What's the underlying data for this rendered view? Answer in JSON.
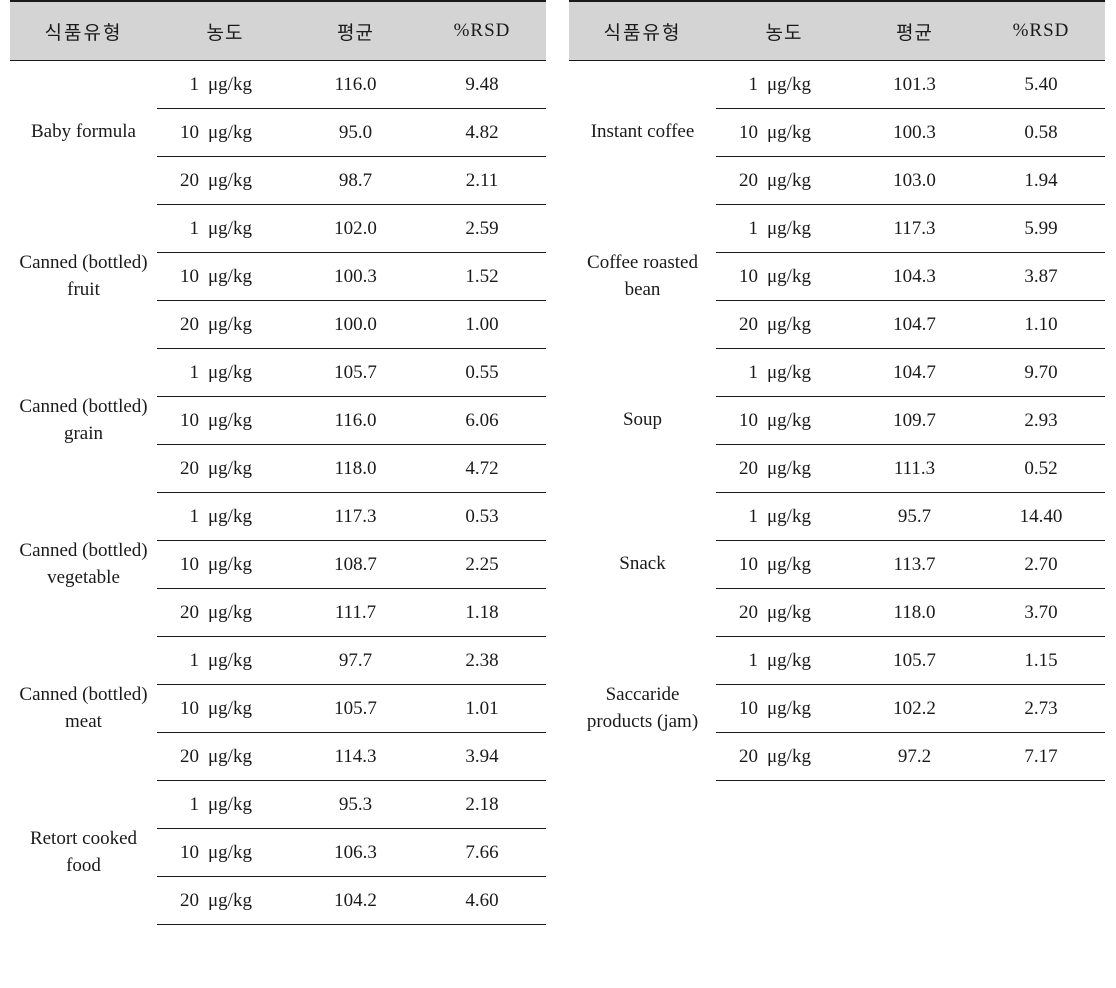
{
  "columns": {
    "food_type": "식품유형",
    "concentration": "농도",
    "mean": "평균",
    "rsd": "%RSD"
  },
  "units": {
    "conc_unit": "μg/kg",
    "levels": [
      "1",
      "10",
      "20"
    ]
  },
  "colors": {
    "header_background": "#d4d4d4",
    "rule": "#1a1a1a",
    "page_background": "#ffffff"
  },
  "left_table": {
    "groups": [
      {
        "food_type": "Baby formula",
        "rows": [
          {
            "conc": "1",
            "unit": "μg/kg",
            "mean": "116.0",
            "rsd": "9.48"
          },
          {
            "conc": "10",
            "unit": "μg/kg",
            "mean": "95.0",
            "rsd": "4.82"
          },
          {
            "conc": "20",
            "unit": "μg/kg",
            "mean": "98.7",
            "rsd": "2.11"
          }
        ]
      },
      {
        "food_type": "Canned (bottled) fruit",
        "rows": [
          {
            "conc": "1",
            "unit": "μg/kg",
            "mean": "102.0",
            "rsd": "2.59"
          },
          {
            "conc": "10",
            "unit": "μg/kg",
            "mean": "100.3",
            "rsd": "1.52"
          },
          {
            "conc": "20",
            "unit": "μg/kg",
            "mean": "100.0",
            "rsd": "1.00"
          }
        ]
      },
      {
        "food_type": "Canned (bottled) grain",
        "rows": [
          {
            "conc": "1",
            "unit": "μg/kg",
            "mean": "105.7",
            "rsd": "0.55"
          },
          {
            "conc": "10",
            "unit": "μg/kg",
            "mean": "116.0",
            "rsd": "6.06"
          },
          {
            "conc": "20",
            "unit": "μg/kg",
            "mean": "118.0",
            "rsd": "4.72"
          }
        ]
      },
      {
        "food_type": "Canned (bottled) vegetable",
        "rows": [
          {
            "conc": "1",
            "unit": "μg/kg",
            "mean": "117.3",
            "rsd": "0.53"
          },
          {
            "conc": "10",
            "unit": "μg/kg",
            "mean": "108.7",
            "rsd": "2.25"
          },
          {
            "conc": "20",
            "unit": "μg/kg",
            "mean": "111.7",
            "rsd": "1.18"
          }
        ]
      },
      {
        "food_type": "Canned (bottled) meat",
        "rows": [
          {
            "conc": "1",
            "unit": "μg/kg",
            "mean": "97.7",
            "rsd": "2.38"
          },
          {
            "conc": "10",
            "unit": "μg/kg",
            "mean": "105.7",
            "rsd": "1.01"
          },
          {
            "conc": "20",
            "unit": "μg/kg",
            "mean": "114.3",
            "rsd": "3.94"
          }
        ]
      },
      {
        "food_type": "Retort cooked food",
        "rows": [
          {
            "conc": "1",
            "unit": "μg/kg",
            "mean": "95.3",
            "rsd": "2.18"
          },
          {
            "conc": "10",
            "unit": "μg/kg",
            "mean": "106.3",
            "rsd": "7.66"
          },
          {
            "conc": "20",
            "unit": "μg/kg",
            "mean": "104.2",
            "rsd": "4.60"
          }
        ]
      }
    ]
  },
  "right_table": {
    "groups": [
      {
        "food_type": "Instant coffee",
        "rows": [
          {
            "conc": "1",
            "unit": "μg/kg",
            "mean": "101.3",
            "rsd": "5.40"
          },
          {
            "conc": "10",
            "unit": "μg/kg",
            "mean": "100.3",
            "rsd": "0.58"
          },
          {
            "conc": "20",
            "unit": "μg/kg",
            "mean": "103.0",
            "rsd": "1.94"
          }
        ]
      },
      {
        "food_type": "Coffee roasted bean",
        "rows": [
          {
            "conc": "1",
            "unit": "μg/kg",
            "mean": "117.3",
            "rsd": "5.99"
          },
          {
            "conc": "10",
            "unit": "μg/kg",
            "mean": "104.3",
            "rsd": "3.87"
          },
          {
            "conc": "20",
            "unit": "μg/kg",
            "mean": "104.7",
            "rsd": "1.10"
          }
        ]
      },
      {
        "food_type": "Soup",
        "rows": [
          {
            "conc": "1",
            "unit": "μg/kg",
            "mean": "104.7",
            "rsd": "9.70"
          },
          {
            "conc": "10",
            "unit": "μg/kg",
            "mean": "109.7",
            "rsd": "2.93"
          },
          {
            "conc": "20",
            "unit": "μg/kg",
            "mean": "111.3",
            "rsd": "0.52"
          }
        ]
      },
      {
        "food_type": "Snack",
        "rows": [
          {
            "conc": "1",
            "unit": "μg/kg",
            "mean": "95.7",
            "rsd": "14.40"
          },
          {
            "conc": "10",
            "unit": "μg/kg",
            "mean": "113.7",
            "rsd": "2.70"
          },
          {
            "conc": "20",
            "unit": "μg/kg",
            "mean": "118.0",
            "rsd": "3.70"
          }
        ]
      },
      {
        "food_type": "Saccaride products (jam)",
        "rows": [
          {
            "conc": "1",
            "unit": "μg/kg",
            "mean": "105.7",
            "rsd": "1.15"
          },
          {
            "conc": "10",
            "unit": "μg/kg",
            "mean": "102.2",
            "rsd": "2.73"
          },
          {
            "conc": "20",
            "unit": "μg/kg",
            "mean": "97.2",
            "rsd": "7.17"
          }
        ]
      }
    ]
  }
}
